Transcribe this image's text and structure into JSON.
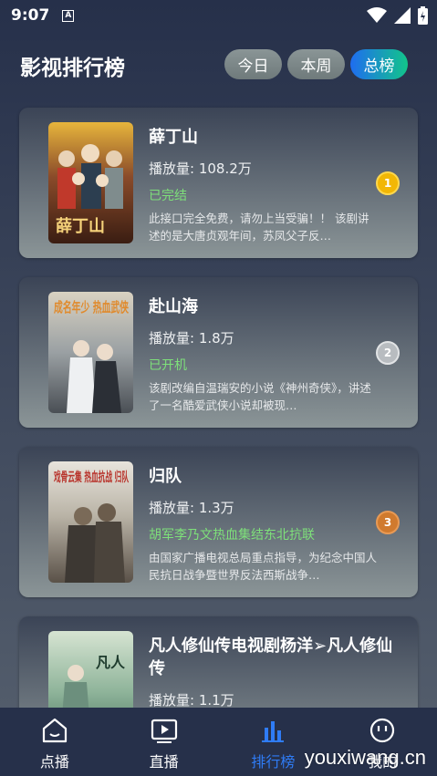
{
  "status_bar": {
    "time": "9:07",
    "notification_icon": "A"
  },
  "header": {
    "title": "影视排行榜",
    "tabs": [
      {
        "label": "今日",
        "active": false
      },
      {
        "label": "本周",
        "active": false
      },
      {
        "label": "总榜",
        "active": true
      }
    ]
  },
  "items": [
    {
      "title": "薛丁山",
      "plays": "播放量: 108.2万",
      "status": "已完结",
      "desc": "此接口完全免费，请勿上当受骗！！ 该剧讲述的是大唐贞观年间，苏凤父子反…",
      "rank": "1",
      "poster_text": "薛丁山"
    },
    {
      "title": "赴山海",
      "plays": "播放量: 1.8万",
      "status": "已开机",
      "desc": "该剧改编自温瑞安的小说《神州奇侠》，讲述了一名酷爱武侠小说却被现…",
      "rank": "2",
      "poster_text": "成名年少 热血武侠"
    },
    {
      "title": "归队",
      "plays": "播放量: 1.3万",
      "status": "胡军李乃文热血集结东北抗联",
      "desc": "由国家广播电视总局重点指导，为纪念中国人民抗日战争暨世界反法西斯战争…",
      "rank": "3",
      "poster_text": "戏骨云集 热血抗战 归队"
    },
    {
      "title": "凡人修仙传电视剧杨洋➢凡人修仙传",
      "plays": "播放量: 1.1万",
      "poster_text": "凡人"
    }
  ],
  "bottom_nav": [
    {
      "label": "点播",
      "icon": "home-icon",
      "active": false
    },
    {
      "label": "直播",
      "icon": "tv-play-icon",
      "active": false
    },
    {
      "label": "排行榜",
      "icon": "bar-chart-icon",
      "active": true
    },
    {
      "label": "我的",
      "icon": "face-icon",
      "active": false
    }
  ],
  "watermark": "youxiwang.cn",
  "colors": {
    "accent_start": "#1f6df0",
    "accent_end": "#12c58a",
    "status_green": "#7ee07a",
    "nav_active": "#2f7cf6"
  }
}
